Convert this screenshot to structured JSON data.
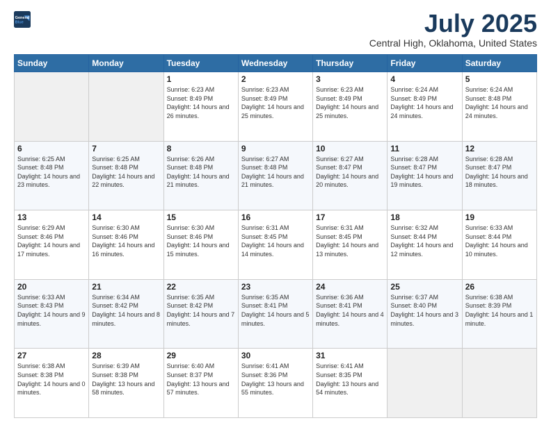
{
  "header": {
    "logo_line1": "General",
    "logo_line2": "Blue",
    "month": "July 2025",
    "location": "Central High, Oklahoma, United States"
  },
  "weekdays": [
    "Sunday",
    "Monday",
    "Tuesday",
    "Wednesday",
    "Thursday",
    "Friday",
    "Saturday"
  ],
  "weeks": [
    [
      {
        "day": "",
        "empty": true
      },
      {
        "day": "",
        "empty": true
      },
      {
        "day": "1",
        "sunrise": "Sunrise: 6:23 AM",
        "sunset": "Sunset: 8:49 PM",
        "daylight": "Daylight: 14 hours and 26 minutes."
      },
      {
        "day": "2",
        "sunrise": "Sunrise: 6:23 AM",
        "sunset": "Sunset: 8:49 PM",
        "daylight": "Daylight: 14 hours and 25 minutes."
      },
      {
        "day": "3",
        "sunrise": "Sunrise: 6:23 AM",
        "sunset": "Sunset: 8:49 PM",
        "daylight": "Daylight: 14 hours and 25 minutes."
      },
      {
        "day": "4",
        "sunrise": "Sunrise: 6:24 AM",
        "sunset": "Sunset: 8:49 PM",
        "daylight": "Daylight: 14 hours and 24 minutes."
      },
      {
        "day": "5",
        "sunrise": "Sunrise: 6:24 AM",
        "sunset": "Sunset: 8:48 PM",
        "daylight": "Daylight: 14 hours and 24 minutes."
      }
    ],
    [
      {
        "day": "6",
        "sunrise": "Sunrise: 6:25 AM",
        "sunset": "Sunset: 8:48 PM",
        "daylight": "Daylight: 14 hours and 23 minutes."
      },
      {
        "day": "7",
        "sunrise": "Sunrise: 6:25 AM",
        "sunset": "Sunset: 8:48 PM",
        "daylight": "Daylight: 14 hours and 22 minutes."
      },
      {
        "day": "8",
        "sunrise": "Sunrise: 6:26 AM",
        "sunset": "Sunset: 8:48 PM",
        "daylight": "Daylight: 14 hours and 21 minutes."
      },
      {
        "day": "9",
        "sunrise": "Sunrise: 6:27 AM",
        "sunset": "Sunset: 8:48 PM",
        "daylight": "Daylight: 14 hours and 21 minutes."
      },
      {
        "day": "10",
        "sunrise": "Sunrise: 6:27 AM",
        "sunset": "Sunset: 8:47 PM",
        "daylight": "Daylight: 14 hours and 20 minutes."
      },
      {
        "day": "11",
        "sunrise": "Sunrise: 6:28 AM",
        "sunset": "Sunset: 8:47 PM",
        "daylight": "Daylight: 14 hours and 19 minutes."
      },
      {
        "day": "12",
        "sunrise": "Sunrise: 6:28 AM",
        "sunset": "Sunset: 8:47 PM",
        "daylight": "Daylight: 14 hours and 18 minutes."
      }
    ],
    [
      {
        "day": "13",
        "sunrise": "Sunrise: 6:29 AM",
        "sunset": "Sunset: 8:46 PM",
        "daylight": "Daylight: 14 hours and 17 minutes."
      },
      {
        "day": "14",
        "sunrise": "Sunrise: 6:30 AM",
        "sunset": "Sunset: 8:46 PM",
        "daylight": "Daylight: 14 hours and 16 minutes."
      },
      {
        "day": "15",
        "sunrise": "Sunrise: 6:30 AM",
        "sunset": "Sunset: 8:46 PM",
        "daylight": "Daylight: 14 hours and 15 minutes."
      },
      {
        "day": "16",
        "sunrise": "Sunrise: 6:31 AM",
        "sunset": "Sunset: 8:45 PM",
        "daylight": "Daylight: 14 hours and 14 minutes."
      },
      {
        "day": "17",
        "sunrise": "Sunrise: 6:31 AM",
        "sunset": "Sunset: 8:45 PM",
        "daylight": "Daylight: 14 hours and 13 minutes."
      },
      {
        "day": "18",
        "sunrise": "Sunrise: 6:32 AM",
        "sunset": "Sunset: 8:44 PM",
        "daylight": "Daylight: 14 hours and 12 minutes."
      },
      {
        "day": "19",
        "sunrise": "Sunrise: 6:33 AM",
        "sunset": "Sunset: 8:44 PM",
        "daylight": "Daylight: 14 hours and 10 minutes."
      }
    ],
    [
      {
        "day": "20",
        "sunrise": "Sunrise: 6:33 AM",
        "sunset": "Sunset: 8:43 PM",
        "daylight": "Daylight: 14 hours and 9 minutes."
      },
      {
        "day": "21",
        "sunrise": "Sunrise: 6:34 AM",
        "sunset": "Sunset: 8:42 PM",
        "daylight": "Daylight: 14 hours and 8 minutes."
      },
      {
        "day": "22",
        "sunrise": "Sunrise: 6:35 AM",
        "sunset": "Sunset: 8:42 PM",
        "daylight": "Daylight: 14 hours and 7 minutes."
      },
      {
        "day": "23",
        "sunrise": "Sunrise: 6:35 AM",
        "sunset": "Sunset: 8:41 PM",
        "daylight": "Daylight: 14 hours and 5 minutes."
      },
      {
        "day": "24",
        "sunrise": "Sunrise: 6:36 AM",
        "sunset": "Sunset: 8:41 PM",
        "daylight": "Daylight: 14 hours and 4 minutes."
      },
      {
        "day": "25",
        "sunrise": "Sunrise: 6:37 AM",
        "sunset": "Sunset: 8:40 PM",
        "daylight": "Daylight: 14 hours and 3 minutes."
      },
      {
        "day": "26",
        "sunrise": "Sunrise: 6:38 AM",
        "sunset": "Sunset: 8:39 PM",
        "daylight": "Daylight: 14 hours and 1 minute."
      }
    ],
    [
      {
        "day": "27",
        "sunrise": "Sunrise: 6:38 AM",
        "sunset": "Sunset: 8:38 PM",
        "daylight": "Daylight: 14 hours and 0 minutes."
      },
      {
        "day": "28",
        "sunrise": "Sunrise: 6:39 AM",
        "sunset": "Sunset: 8:38 PM",
        "daylight": "Daylight: 13 hours and 58 minutes."
      },
      {
        "day": "29",
        "sunrise": "Sunrise: 6:40 AM",
        "sunset": "Sunset: 8:37 PM",
        "daylight": "Daylight: 13 hours and 57 minutes."
      },
      {
        "day": "30",
        "sunrise": "Sunrise: 6:41 AM",
        "sunset": "Sunset: 8:36 PM",
        "daylight": "Daylight: 13 hours and 55 minutes."
      },
      {
        "day": "31",
        "sunrise": "Sunrise: 6:41 AM",
        "sunset": "Sunset: 8:35 PM",
        "daylight": "Daylight: 13 hours and 54 minutes."
      },
      {
        "day": "",
        "empty": true
      },
      {
        "day": "",
        "empty": true
      }
    ]
  ]
}
